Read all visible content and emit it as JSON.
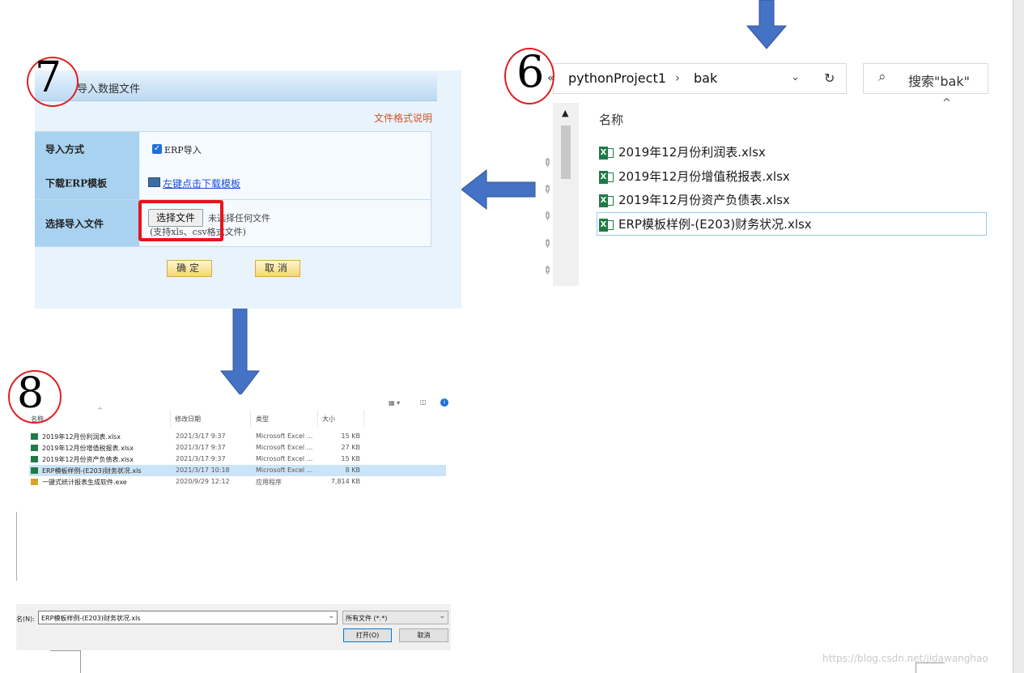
{
  "panel7": {
    "number": "7",
    "title": "导入数据文件",
    "format_link": "文件格式说明",
    "rows": [
      {
        "label": "导入方式",
        "checkbox_label": "ERP导入"
      },
      {
        "label": "下载ERP模板",
        "link": "左键点击下载模板"
      },
      {
        "label": "选择导入文件",
        "button": "选择文件",
        "status": "未选择任何文件",
        "hint": "(支持xls、csv格式文件)"
      }
    ],
    "confirm": "确定",
    "cancel": "取消"
  },
  "panel6": {
    "number": "6",
    "breadcrumb": [
      "pythonProject1",
      "bak"
    ],
    "search_placeholder": "搜索\"bak\"",
    "column_name": "名称",
    "files": [
      "2019年12月份利润表.xlsx",
      "2019年12月份增值税报表.xlsx",
      "2019年12月份资产负债表.xlsx",
      "ERP模板样例-(E203)财务状况.xlsx"
    ]
  },
  "panel8": {
    "number": "8",
    "headers": {
      "name": "名称",
      "date": "修改日期",
      "type": "类型",
      "size": "大小"
    },
    "files": [
      {
        "name": "2019年12月份利润表.xlsx",
        "date": "2021/3/17 9:37",
        "type": "Microsoft Excel ...",
        "size": "15 KB"
      },
      {
        "name": "2019年12月份增值税报表.xlsx",
        "date": "2021/3/17 9:37",
        "type": "Microsoft Excel ...",
        "size": "27 KB"
      },
      {
        "name": "2019年12月份资产负债表.xlsx",
        "date": "2021/3/17 9:37",
        "type": "Microsoft Excel ...",
        "size": "15 KB"
      },
      {
        "name": "ERP模板样例-(E203)财务状况.xls",
        "date": "2021/3/17 10:18",
        "type": "Microsoft Excel ...",
        "size": "8 KB"
      },
      {
        "name": "一键式统计报表生成软件.exe",
        "date": "2020/9/29 12:12",
        "type": "应用程序",
        "size": "7,814 KB"
      }
    ],
    "filename_label": "名(N):",
    "filename_value": "ERP模板样例-(E203)财务状况.xls",
    "filter": "所有文件 (*.*)",
    "open_button": "打开(O)",
    "cancel_button": "取消"
  },
  "watermark": "https://blog.csdn.net/jidawanghao",
  "colors": {
    "arrow": "#4472c4",
    "highlight": "#e02020",
    "excel": "#1f7a45"
  }
}
